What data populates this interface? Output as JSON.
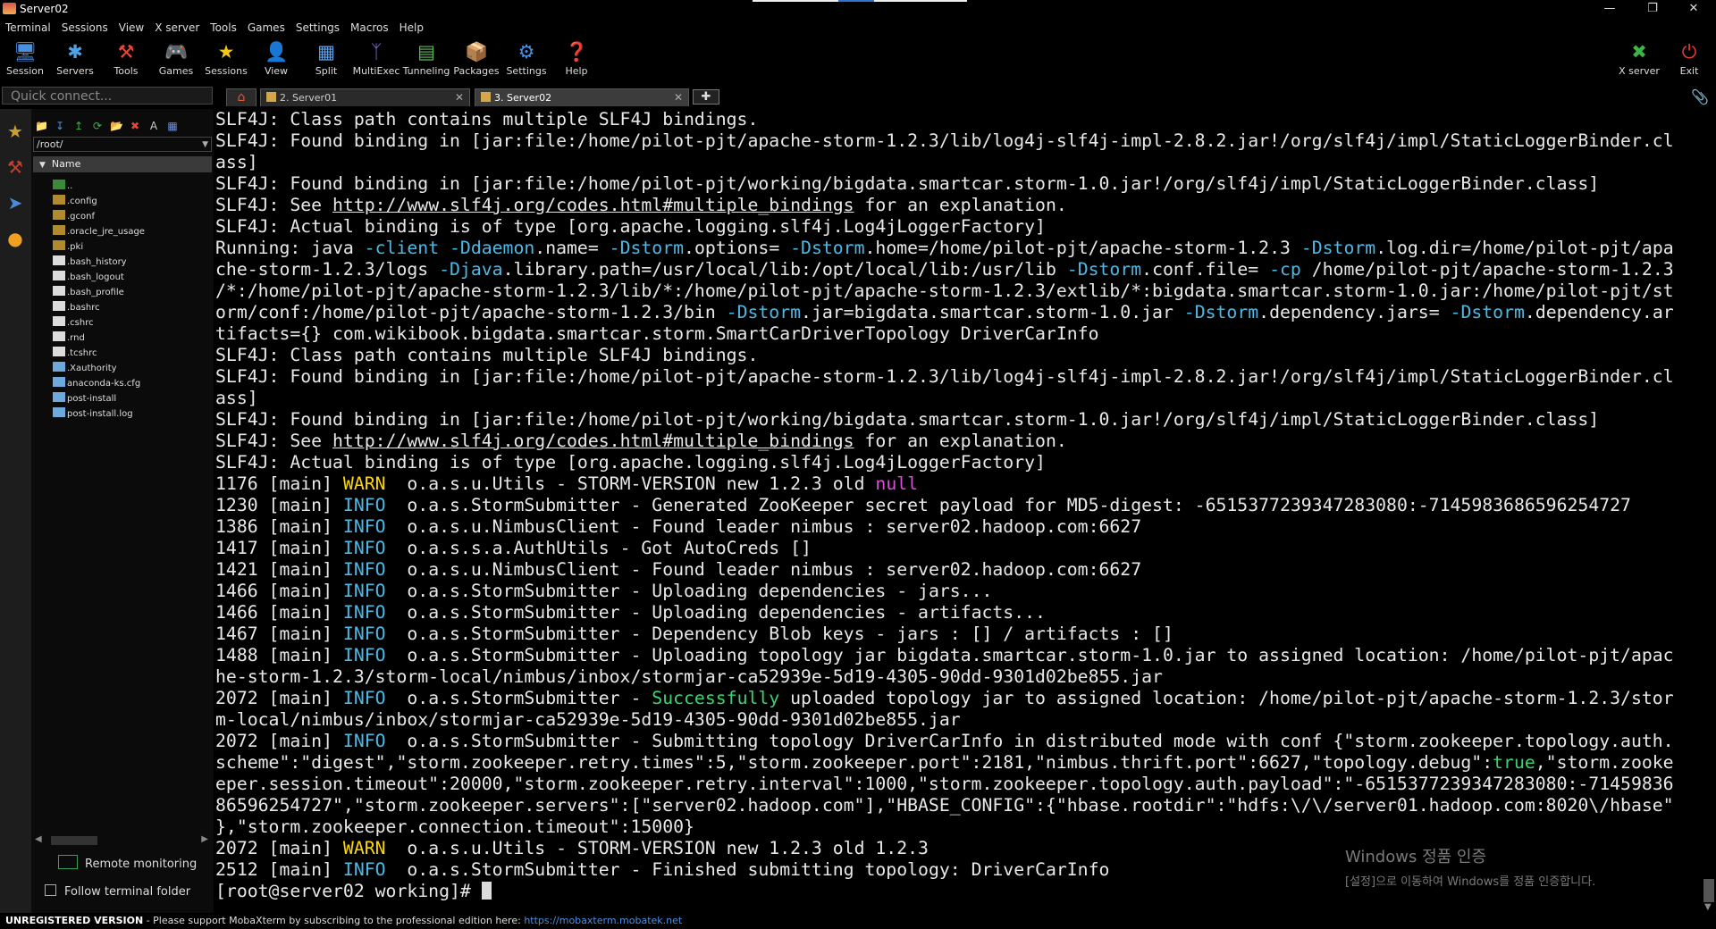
{
  "window": {
    "title": "Server02"
  },
  "menu": [
    "Terminal",
    "Sessions",
    "View",
    "X server",
    "Tools",
    "Games",
    "Settings",
    "Macros",
    "Help"
  ],
  "toolbar": {
    "buttons": [
      {
        "label": "Session",
        "icon": "session-icon"
      },
      {
        "label": "Servers",
        "icon": "servers-icon"
      },
      {
        "label": "Tools",
        "icon": "tools-icon"
      },
      {
        "label": "Games",
        "icon": "gamepad-icon"
      },
      {
        "label": "Sessions",
        "icon": "star-icon"
      },
      {
        "label": "View",
        "icon": "view-icon"
      },
      {
        "label": "Split",
        "icon": "split-icon"
      },
      {
        "label": "MultiExec",
        "icon": "multiexec-icon"
      },
      {
        "label": "Tunneling",
        "icon": "tunneling-icon"
      },
      {
        "label": "Packages",
        "icon": "packages-icon"
      },
      {
        "label": "Settings",
        "icon": "gears-icon"
      },
      {
        "label": "Help",
        "icon": "help-icon"
      }
    ],
    "xserver_label": "X server",
    "exit_label": "Exit"
  },
  "quick_connect": {
    "placeholder": "Quick connect..."
  },
  "tabs": [
    {
      "label": "2. Server01",
      "active": false
    },
    {
      "label": "3. Server02",
      "active": true
    }
  ],
  "sidebar": {
    "path": "/root/",
    "column_header": "Name",
    "files": [
      {
        "name": "..",
        "type": "up"
      },
      {
        "name": ".config",
        "type": "folder"
      },
      {
        "name": ".gconf",
        "type": "folder"
      },
      {
        "name": ".oracle_jre_usage",
        "type": "folder"
      },
      {
        "name": ".pki",
        "type": "folder"
      },
      {
        "name": ".bash_history",
        "type": "file"
      },
      {
        "name": ".bash_logout",
        "type": "file"
      },
      {
        "name": ".bash_profile",
        "type": "file"
      },
      {
        "name": ".bashrc",
        "type": "file"
      },
      {
        "name": ".cshrc",
        "type": "file"
      },
      {
        "name": ".rnd",
        "type": "file"
      },
      {
        "name": ".tcshrc",
        "type": "file"
      },
      {
        "name": ".Xauthority",
        "type": "doc"
      },
      {
        "name": "anaconda-ks.cfg",
        "type": "doc"
      },
      {
        "name": "post-install",
        "type": "doc"
      },
      {
        "name": "post-install.log",
        "type": "doc"
      }
    ],
    "remote_monitoring": "Remote monitoring",
    "follow_terminal": "Follow terminal folder"
  },
  "terminal": {
    "lines": [
      [
        [
          "SLF4J: Class path contains multiple SLF4J bindings.",
          ""
        ]
      ],
      [
        [
          "SLF4J: Found binding in [jar:file:/home/pilot-pjt/apache-storm-1.2.3/lib/log4j-slf4j-impl-2.8.2.jar!/org/slf4j/impl/StaticLoggerBinder.cl",
          ""
        ]
      ],
      [
        [
          "ass]",
          ""
        ]
      ],
      [
        [
          "SLF4J: Found binding in [jar:file:/home/pilot-pjt/working/bigdata.smartcar.storm-1.0.jar!/org/slf4j/impl/StaticLoggerBinder.class]",
          ""
        ]
      ],
      [
        [
          "SLF4J: See ",
          ""
        ],
        [
          "http://www.slf4j.org/codes.html#multiple_bindings",
          "u"
        ],
        [
          " for an explanation.",
          ""
        ]
      ],
      [
        [
          "SLF4J: Actual binding is of type [org.apache.logging.slf4j.Log4jLoggerFactory]",
          ""
        ]
      ],
      [
        [
          "Running: java ",
          ""
        ],
        [
          "-client -Ddaemon",
          "cy"
        ],
        [
          ".name= ",
          ""
        ],
        [
          "-Dstorm",
          "cy"
        ],
        [
          ".options= ",
          ""
        ],
        [
          "-Dstorm",
          "cy"
        ],
        [
          ".home=/home/pilot-pjt/apache-storm-1.2.3 ",
          ""
        ],
        [
          "-Dstorm",
          "cy"
        ],
        [
          ".log.dir=/home/pilot-pjt/apa",
          ""
        ]
      ],
      [
        [
          "che-storm-1.2.3/logs ",
          ""
        ],
        [
          "-Djava",
          "cy"
        ],
        [
          ".library.path=/usr/local/lib:/opt/local/lib:/usr/lib ",
          ""
        ],
        [
          "-Dstorm",
          "cy"
        ],
        [
          ".conf.file= ",
          ""
        ],
        [
          "-cp",
          "cy"
        ],
        [
          " /home/pilot-pjt/apache-storm-1.2.3",
          ""
        ]
      ],
      [
        [
          "/*:/home/pilot-pjt/apache-storm-1.2.3/lib/*:/home/pilot-pjt/apache-storm-1.2.3/extlib/*:bigdata.smartcar.storm-1.0.jar:/home/pilot-pjt/st",
          ""
        ]
      ],
      [
        [
          "orm/conf:/home/pilot-pjt/apache-storm-1.2.3/bin ",
          ""
        ],
        [
          "-Dstorm",
          "cy"
        ],
        [
          ".jar=bigdata.smartcar.storm-1.0.jar ",
          ""
        ],
        [
          "-Dstorm",
          "cy"
        ],
        [
          ".dependency.jars= ",
          ""
        ],
        [
          "-Dstorm",
          "cy"
        ],
        [
          ".dependency.ar",
          ""
        ]
      ],
      [
        [
          "tifacts={} com.wikibook.bigdata.smartcar.storm.SmartCarDriverTopology DriverCarInfo",
          ""
        ]
      ],
      [
        [
          "SLF4J: Class path contains multiple SLF4J bindings.",
          ""
        ]
      ],
      [
        [
          "SLF4J: Found binding in [jar:file:/home/pilot-pjt/apache-storm-1.2.3/lib/log4j-slf4j-impl-2.8.2.jar!/org/slf4j/impl/StaticLoggerBinder.cl",
          ""
        ]
      ],
      [
        [
          "ass]",
          ""
        ]
      ],
      [
        [
          "SLF4J: Found binding in [jar:file:/home/pilot-pjt/working/bigdata.smartcar.storm-1.0.jar!/org/slf4j/impl/StaticLoggerBinder.class]",
          ""
        ]
      ],
      [
        [
          "SLF4J: See ",
          ""
        ],
        [
          "http://www.slf4j.org/codes.html#multiple_bindings",
          "u"
        ],
        [
          " for an explanation.",
          ""
        ]
      ],
      [
        [
          "SLF4J: Actual binding is of type [org.apache.logging.slf4j.Log4jLoggerFactory]",
          ""
        ]
      ],
      [
        [
          "1176 [main] ",
          ""
        ],
        [
          "WARN",
          "yel"
        ],
        [
          "  o.a.s.u.Utils - STORM-VERSION new 1.2.3 old ",
          ""
        ],
        [
          "null",
          "mag"
        ]
      ],
      [
        [
          "1230 [main] ",
          ""
        ],
        [
          "INFO",
          "cy"
        ],
        [
          "  o.a.s.StormSubmitter - Generated ZooKeeper secret payload for MD5-digest: -6515377239347283080:-7145983686596254727",
          ""
        ]
      ],
      [
        [
          "1386 [main] ",
          ""
        ],
        [
          "INFO",
          "cy"
        ],
        [
          "  o.a.s.u.NimbusClient - Found leader nimbus : server02.hadoop.com:6627",
          ""
        ]
      ],
      [
        [
          "1417 [main] ",
          ""
        ],
        [
          "INFO",
          "cy"
        ],
        [
          "  o.a.s.s.a.AuthUtils - Got AutoCreds []",
          ""
        ]
      ],
      [
        [
          "1421 [main] ",
          ""
        ],
        [
          "INFO",
          "cy"
        ],
        [
          "  o.a.s.u.NimbusClient - Found leader nimbus : server02.hadoop.com:6627",
          ""
        ]
      ],
      [
        [
          "1466 [main] ",
          ""
        ],
        [
          "INFO",
          "cy"
        ],
        [
          "  o.a.s.StormSubmitter - Uploading dependencies - jars...",
          ""
        ]
      ],
      [
        [
          "1466 [main] ",
          ""
        ],
        [
          "INFO",
          "cy"
        ],
        [
          "  o.a.s.StormSubmitter - Uploading dependencies - artifacts...",
          ""
        ]
      ],
      [
        [
          "1467 [main] ",
          ""
        ],
        [
          "INFO",
          "cy"
        ],
        [
          "  o.a.s.StormSubmitter - Dependency Blob keys - jars : [] / artifacts : []",
          ""
        ]
      ],
      [
        [
          "1488 [main] ",
          ""
        ],
        [
          "INFO",
          "cy"
        ],
        [
          "  o.a.s.StormSubmitter - Uploading topology jar bigdata.smartcar.storm-1.0.jar to assigned location: /home/pilot-pjt/apac",
          ""
        ]
      ],
      [
        [
          "he-storm-1.2.3/storm-local/nimbus/inbox/stormjar-ca52939e-5d19-4305-90dd-9301d02be855.jar",
          ""
        ]
      ],
      [
        [
          "2072 [main] ",
          ""
        ],
        [
          "INFO",
          "cy"
        ],
        [
          "  o.a.s.StormSubmitter - ",
          ""
        ],
        [
          "Successfully",
          "grn"
        ],
        [
          " uploaded topology jar to assigned location: /home/pilot-pjt/apache-storm-1.2.3/stor",
          ""
        ]
      ],
      [
        [
          "m-local/nimbus/inbox/stormjar-ca52939e-5d19-4305-90dd-9301d02be855.jar",
          ""
        ]
      ],
      [
        [
          "2072 [main] ",
          ""
        ],
        [
          "INFO",
          "cy"
        ],
        [
          "  o.a.s.StormSubmitter - Submitting topology DriverCarInfo in distributed mode with conf {\"storm.zookeeper.topology.auth.",
          ""
        ]
      ],
      [
        [
          "scheme\":\"digest\",\"storm.zookeeper.retry.times\":5,\"storm.zookeeper.port\":2181,\"nimbus.thrift.port\":6627,\"topology.debug\":",
          ""
        ],
        [
          "true",
          "grn"
        ],
        [
          ",\"storm.zooke",
          ""
        ]
      ],
      [
        [
          "eper.session.timeout\":20000,\"storm.zookeeper.retry.interval\":1000,\"storm.zookeeper.topology.auth.payload\":\"-6515377239347283080:-71459836",
          ""
        ]
      ],
      [
        [
          "86596254727\",\"storm.zookeeper.servers\":[\"server02.hadoop.com\"],\"HBASE_CONFIG\":{\"hbase.rootdir\":\"hdfs:\\/\\/server01.hadoop.com:8020\\/hbase\"",
          ""
        ]
      ],
      [
        [
          "},\"storm.zookeeper.connection.timeout\":15000}",
          ""
        ]
      ],
      [
        [
          "2072 [main] ",
          ""
        ],
        [
          "WARN",
          "yel"
        ],
        [
          "  o.a.s.u.Utils - STORM-VERSION new 1.2.3 old 1.2.3",
          ""
        ]
      ],
      [
        [
          "2512 [main] ",
          ""
        ],
        [
          "INFO",
          "cy"
        ],
        [
          "  o.a.s.StormSubmitter - Finished submitting topology: DriverCarInfo",
          ""
        ]
      ]
    ],
    "prompt": "[root@server02 working]# "
  },
  "watermark": {
    "line1": "Windows 정품 인증",
    "line2": "[설정]으로 이동하여 Windows를 정품 인증합니다."
  },
  "statusbar": {
    "bold": "UNREGISTERED VERSION",
    "text": "  -  Please support MobaXterm by subscribing to the professional edition here:  ",
    "link": "https://mobaxterm.mobatek.net"
  },
  "colors": {
    "accent_blue": "#2f74d0",
    "info_cyan": "#4fb8e3",
    "warn_yellow": "#ffd700",
    "null_magenta": "#d84ed8",
    "success_green": "#3cd470"
  }
}
